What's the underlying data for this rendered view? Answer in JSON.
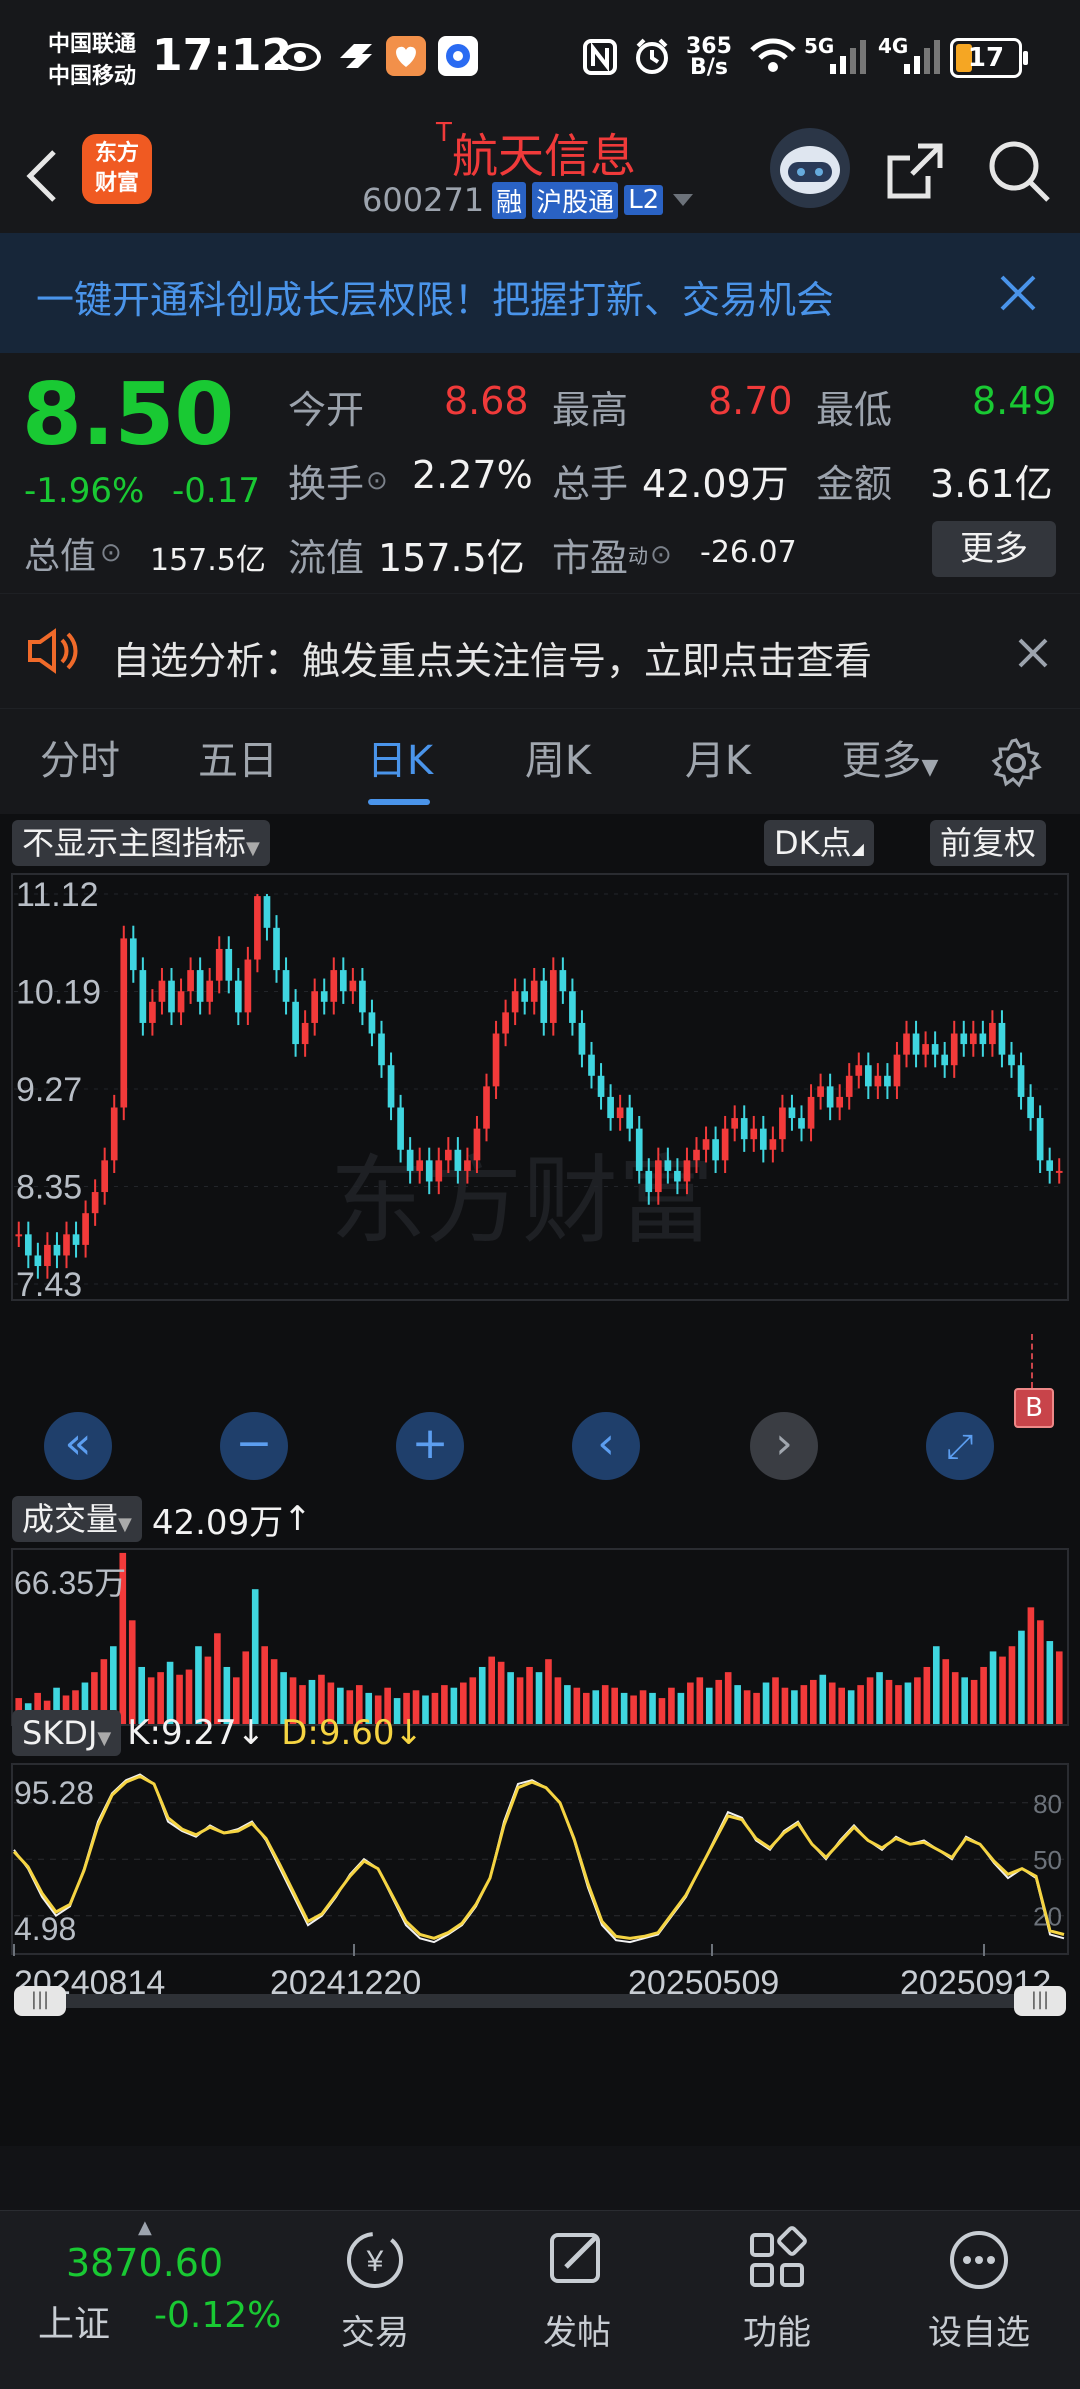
{
  "status_bar": {
    "carrier1": "中国联通",
    "carrier2": "中国移动",
    "time": "17:12",
    "net_speed_top": "365",
    "net_speed_bottom": "B/s",
    "sim1_type": "5G",
    "sim2_type": "4G",
    "battery": "17"
  },
  "header": {
    "logo_line1": "东方",
    "logo_line2": "财富",
    "t_mark": "T",
    "stock_name": "航天信息",
    "stock_code": "600271",
    "badge_margin": "融",
    "badge_connect": "沪股通",
    "badge_level": "L2"
  },
  "promo": {
    "text": "一键开通科创成长层权限！把握打新、交易机会"
  },
  "quote": {
    "price": "8.50",
    "change_pct": "-1.96%",
    "change": "-0.17",
    "open_label": "今开",
    "open_value": "8.68",
    "high_label": "最高",
    "high_value": "8.70",
    "low_label": "最低",
    "low_value": "8.49",
    "turnover_label": "换手",
    "turnover_value": "2.27%",
    "volume_label": "总手",
    "volume_value": "42.09万",
    "amount_label": "金额",
    "amount_value": "3.61亿",
    "mktcap_label": "总值",
    "mktcap_value": "157.5亿",
    "float_label": "流值",
    "float_value": "157.5亿",
    "pe_label": "市盈",
    "pe_sup": "动",
    "pe_value": "-26.07",
    "more_button": "更多"
  },
  "alert": {
    "text": "自选分析：触发重点关注信号，立即点击查看"
  },
  "tabs": {
    "items": [
      "分时",
      "五日",
      "日K",
      "周K",
      "月K",
      "更多"
    ],
    "active": "日K"
  },
  "chart_controls": {
    "indicator_select": "不显示主图指标",
    "dk_button": "DK点",
    "adjust_button": "前复权",
    "volume_select": "成交量",
    "volume_value": "42.09万",
    "skdj_select": "SKDJ",
    "skdj_k": "K:9.27",
    "skdj_d": "D:9.60",
    "b_marker": "B"
  },
  "chart_data": [
    {
      "type": "candlestick",
      "y_ticks": [
        "11.12",
        "10.19",
        "9.27",
        "8.35",
        "7.43"
      ],
      "ylim": [
        7.43,
        11.12
      ],
      "colors": {
        "up": "#f23a3a",
        "down": "#3fd6e0"
      },
      "closes": [
        7.9,
        7.7,
        7.6,
        7.8,
        7.7,
        7.9,
        7.8,
        8.1,
        8.3,
        8.6,
        9.1,
        10.7,
        10.4,
        9.9,
        10.1,
        10.3,
        10.0,
        10.2,
        10.4,
        10.1,
        10.3,
        10.6,
        10.3,
        10.0,
        10.5,
        11.1,
        10.8,
        10.4,
        10.1,
        9.7,
        9.9,
        10.2,
        10.1,
        10.4,
        10.2,
        10.3,
        10.0,
        9.8,
        9.5,
        9.1,
        8.7,
        8.5,
        8.6,
        8.4,
        8.6,
        8.7,
        8.5,
        8.6,
        8.9,
        9.3,
        9.8,
        10.0,
        10.2,
        10.1,
        10.3,
        9.9,
        10.4,
        10.2,
        9.9,
        9.6,
        9.4,
        9.2,
        9.0,
        9.1,
        8.9,
        8.5,
        8.3,
        8.6,
        8.5,
        8.4,
        8.6,
        8.7,
        8.8,
        8.6,
        8.9,
        9.0,
        8.8,
        8.9,
        8.7,
        8.8,
        9.1,
        9.0,
        8.9,
        9.2,
        9.3,
        9.1,
        9.2,
        9.4,
        9.5,
        9.3,
        9.4,
        9.3,
        9.6,
        9.8,
        9.6,
        9.7,
        9.6,
        9.5,
        9.8,
        9.7,
        9.8,
        9.7,
        9.9,
        9.6,
        9.5,
        9.2,
        9.0,
        8.6,
        8.5,
        8.5
      ],
      "dates_labels": [
        "20240814",
        "20241220",
        "20250509",
        "20250912"
      ]
    },
    {
      "type": "bar",
      "title": "成交量",
      "y_ticks": [
        "66.35万"
      ],
      "ylim": [
        0,
        66.35
      ],
      "values": [
        10,
        8,
        12,
        9,
        14,
        11,
        13,
        16,
        20,
        25,
        30,
        66,
        40,
        22,
        18,
        20,
        24,
        19,
        21,
        30,
        26,
        35,
        22,
        18,
        28,
        52,
        30,
        25,
        20,
        18,
        15,
        17,
        19,
        16,
        14,
        13,
        15,
        12,
        11,
        14,
        10,
        12,
        13,
        11,
        12,
        15,
        14,
        16,
        18,
        22,
        26,
        24,
        20,
        18,
        22,
        20,
        25,
        18,
        15,
        14,
        12,
        13,
        15,
        14,
        12,
        11,
        13,
        12,
        10,
        14,
        12,
        16,
        18,
        14,
        17,
        20,
        15,
        13,
        12,
        16,
        18,
        14,
        13,
        15,
        17,
        19,
        16,
        14,
        13,
        15,
        18,
        20,
        17,
        15,
        16,
        18,
        22,
        30,
        25,
        20,
        18,
        17,
        22,
        28,
        26,
        30,
        36,
        45,
        40,
        32,
        28
      ]
    },
    {
      "type": "line",
      "title": "SKDJ",
      "y_ticks": [
        "95.28",
        "4.98"
      ],
      "right_ticks": [
        "80",
        "50",
        "20"
      ],
      "ylim": [
        4.98,
        95.28
      ],
      "series": [
        {
          "name": "K",
          "values": [
            55,
            45,
            30,
            20,
            25,
            45,
            70,
            85,
            92,
            95,
            90,
            70,
            65,
            62,
            68,
            64,
            66,
            70,
            60,
            45,
            30,
            15,
            20,
            30,
            42,
            50,
            45,
            30,
            15,
            8,
            6,
            10,
            15,
            25,
            40,
            70,
            90,
            92,
            88,
            80,
            60,
            35,
            15,
            7,
            6,
            8,
            10,
            20,
            30,
            45,
            60,
            75,
            72,
            60,
            55,
            65,
            70,
            58,
            50,
            60,
            68,
            60,
            55,
            62,
            58,
            60,
            55,
            50,
            62,
            58,
            48,
            40,
            45,
            40,
            10,
            8
          ]
        },
        {
          "name": "D",
          "values": [
            54,
            46,
            32,
            22,
            26,
            44,
            68,
            84,
            91,
            94,
            90,
            72,
            66,
            63,
            67,
            64,
            65,
            69,
            61,
            47,
            32,
            17,
            21,
            31,
            41,
            49,
            45,
            31,
            17,
            10,
            8,
            11,
            16,
            26,
            40,
            68,
            88,
            91,
            88,
            80,
            61,
            37,
            17,
            9,
            8,
            9,
            11,
            21,
            31,
            45,
            59,
            73,
            71,
            61,
            56,
            64,
            69,
            58,
            51,
            59,
            67,
            60,
            56,
            61,
            58,
            59,
            55,
            51,
            61,
            58,
            49,
            42,
            45,
            41,
            12,
            10
          ]
        }
      ]
    }
  ],
  "bottom_nav": {
    "index_value": "3870.60",
    "index_name": "上证",
    "index_change": "-0.12%",
    "trade": "交易",
    "post": "发帖",
    "features": "功能",
    "watchlist": "设自选"
  }
}
